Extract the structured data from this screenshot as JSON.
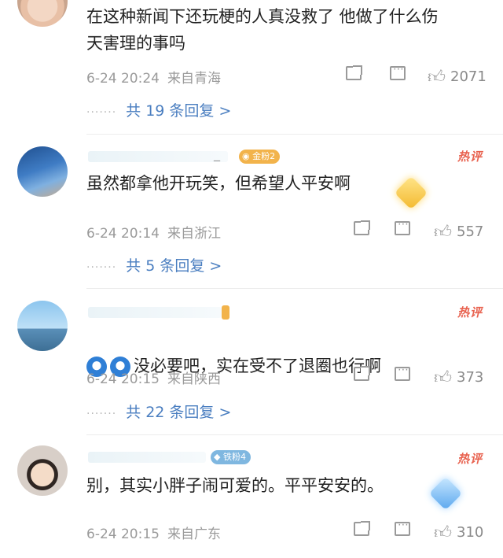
{
  "comments": [
    {
      "text": "在这种新闻下还玩梗的人真没救了 他做了什么伤\n天害理的事吗",
      "date": "6-24 20:24",
      "location": "来自青海",
      "likes": "2071",
      "replies": "共 19 条回复 >"
    },
    {
      "username_partial": "_",
      "badge": "金粉2",
      "hot_label": "热评",
      "text": "虽然都拿他开玩笑，但希望人平安啊",
      "date": "6-24 20:14",
      "location": "来自浙江",
      "likes": "557",
      "replies": "共 5 条回复 >"
    },
    {
      "hot_label": "热评",
      "text": "没必要吧，实在受不了退圈也行啊",
      "date": "6-24 20:15",
      "location": "来自陕西",
      "likes": "373",
      "replies": "共 22 条回复 >"
    },
    {
      "badge": "铁粉4",
      "hot_label": "热评",
      "text": "别，其实小胖子闹可爱的。平平安安的。",
      "date": "6-24 20:15",
      "location": "来自广东",
      "likes": "310"
    }
  ],
  "colors": {
    "reply_link": "#4a7ec0",
    "hot": "#e8614e",
    "meta": "#9a9a9a"
  },
  "icons": [
    "share-icon",
    "message-icon",
    "thumbs-up-icon",
    "gold-fan-badge-icon",
    "diamond-sticker-icon",
    "doraemon-emoji-icon"
  ]
}
